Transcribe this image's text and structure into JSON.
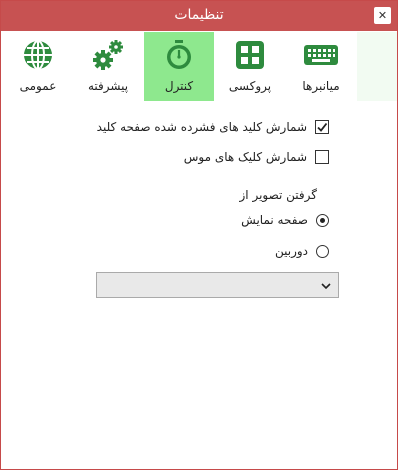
{
  "window": {
    "title": "تنظیمات",
    "close_glyph": "✕"
  },
  "tabs": [
    {
      "id": "general",
      "label": "عمومی",
      "icon": "globe-icon",
      "selected": false
    },
    {
      "id": "advanced",
      "label": "پیشرفته",
      "icon": "gears-icon",
      "selected": false
    },
    {
      "id": "control",
      "label": "کنترل",
      "icon": "stopwatch-icon",
      "selected": true
    },
    {
      "id": "proxy",
      "label": "پروکسی",
      "icon": "grid-icon",
      "selected": false
    },
    {
      "id": "shortcuts",
      "label": "میانبرها",
      "icon": "keyboard-icon",
      "selected": false
    }
  ],
  "colors": {
    "titlebar": "#c75252",
    "selected_tab": "#8ee88e",
    "icon_green": "#2e8b3e"
  },
  "options": {
    "show_keys_label": "شمارش کلید های فشرده شده صفحه کلید",
    "show_keys_checked": true,
    "count_clicks_label": "شمارش کلیک های موس",
    "count_clicks_checked": false
  },
  "capture": {
    "group_label": "گرفتن تصویر از",
    "screen_label": "صفحه نمایش",
    "screen_selected": true,
    "camera_label": "دوربین",
    "camera_selected": false,
    "device_value": ""
  }
}
